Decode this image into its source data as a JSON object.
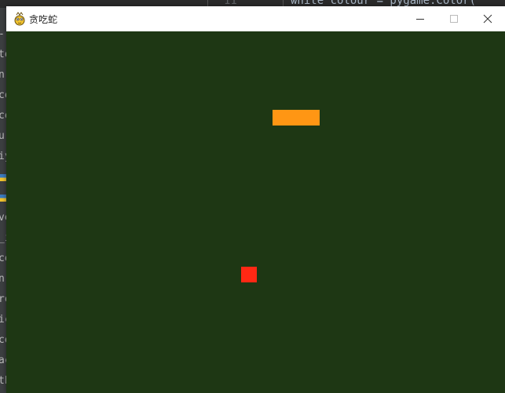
{
  "background_editor": {
    "line_number": "11",
    "code_fragment": "white_colour = pygame.Color(",
    "left_fragments": [
      "-",
      "to",
      "n-",
      "co",
      "co",
      "ur",
      "iy",
      "",
      "",
      "ve",
      "_i",
      "co",
      "n-",
      "ro",
      "ic",
      "co",
      "ac",
      "th"
    ]
  },
  "window": {
    "title": "贪吃蛇",
    "icon": "pygame-snake-icon"
  },
  "game": {
    "background_color": "#1e3714",
    "snake_color": "#ff9614",
    "food_color": "#ff2814",
    "snake": [
      {
        "col": 17,
        "row": 5
      },
      {
        "col": 18,
        "row": 5
      },
      {
        "col": 19,
        "row": 5
      }
    ],
    "food": {
      "col": 15,
      "row": 15
    }
  }
}
